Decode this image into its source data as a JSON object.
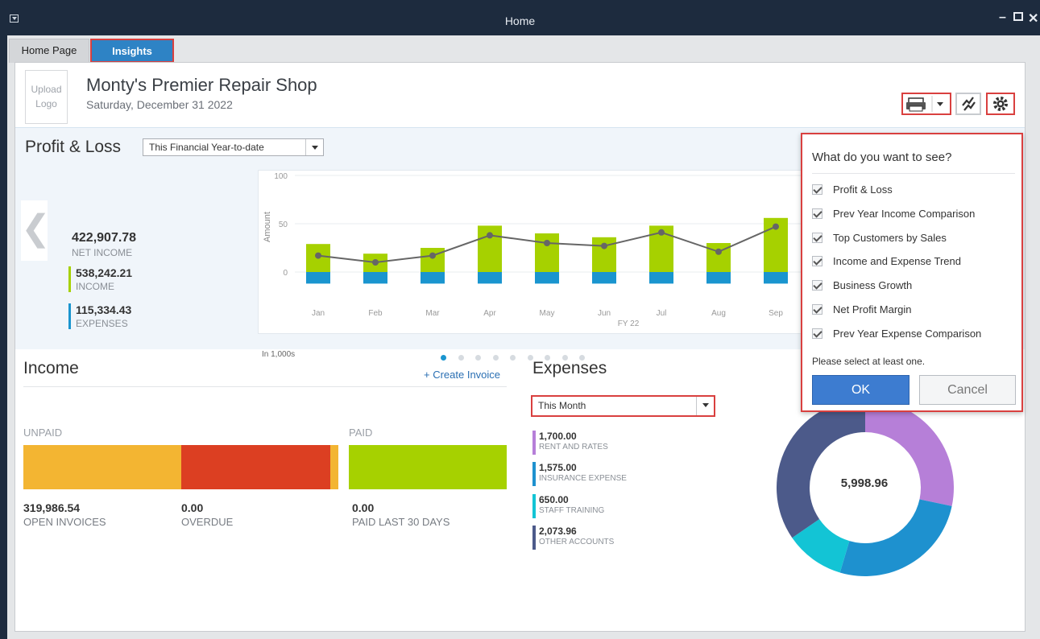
{
  "window": {
    "title": "Home"
  },
  "tabs": [
    {
      "label": "Home Page"
    },
    {
      "label": "Insights"
    }
  ],
  "header": {
    "logo_text": "Upload Logo",
    "company": "Monty's Premier Repair Shop",
    "date": "Saturday, December 31 2022"
  },
  "profit_loss": {
    "title": "Profit & Loss",
    "period": "This Financial Year-to-date",
    "net_income": "422,907.78",
    "net_income_label": "NET INCOME",
    "income": "538,242.21",
    "income_label": "INCOME",
    "expenses": "115,334.43",
    "expenses_label": "EXPENSES",
    "units_note": "In 1,000s"
  },
  "chart_data": {
    "type": "bar",
    "categories": [
      "Jan",
      "Feb",
      "Mar",
      "Apr",
      "May",
      "Jun",
      "Jul",
      "Aug",
      "Sep"
    ],
    "xlabel": "FY 22",
    "ylabel": "Amount",
    "yticks": [
      "100",
      "50",
      "0"
    ],
    "ylim": [
      -12,
      100
    ],
    "series": [
      {
        "values": [
          29,
          19,
          25,
          48,
          40,
          36,
          48,
          30,
          56
        ]
      },
      {
        "values": [
          -12,
          -12,
          -12,
          -12,
          -12,
          -12,
          -12,
          -12,
          -12
        ]
      },
      {
        "values": [
          17,
          10,
          17,
          38,
          30,
          27,
          41,
          21,
          47
        ]
      }
    ],
    "colors": {
      "income": "#a6d100",
      "expenses": "#1a95cf",
      "net": "#666666"
    },
    "grid": true
  },
  "income": {
    "title": "Income",
    "create_invoice": "+ Create Invoice",
    "unpaid_label": "UNPAID",
    "paid_label": "PAID",
    "open_invoices": "319,986.54",
    "open_invoices_label": "OPEN INVOICES",
    "overdue": "0.00",
    "overdue_label": "OVERDUE",
    "paid_last_30": "0.00",
    "paid_last_30_label": "PAID LAST 30 DAYS",
    "colors": {
      "open": "#f3b532",
      "overdue": "#dc3f22",
      "paid": "#a6d100"
    }
  },
  "expenses": {
    "title": "Expenses",
    "period": "This Month",
    "total": "5,998.96",
    "items": [
      {
        "value": "1,700.00",
        "label": "RENT AND RATES",
        "color": "#b67fd8"
      },
      {
        "value": "1,575.00",
        "label": "INSURANCE EXPENSE",
        "color": "#1e91cf"
      },
      {
        "value": "650.00",
        "label": "STAFF TRAINING",
        "color": "#13c4d5"
      },
      {
        "value": "2,073.96",
        "label": "OTHER ACCOUNTS",
        "color": "#4c5a8a"
      }
    ]
  },
  "popup": {
    "title": "What do you want to see?",
    "options": [
      {
        "label": "Profit & Loss",
        "checked": true
      },
      {
        "label": "Prev Year Income Comparison",
        "checked": true
      },
      {
        "label": "Top Customers by Sales",
        "checked": true
      },
      {
        "label": "Income and Expense Trend",
        "checked": true
      },
      {
        "label": "Business Growth",
        "checked": true
      },
      {
        "label": "Net Profit Margin",
        "checked": true
      },
      {
        "label": "Prev Year Expense Comparison",
        "checked": true
      }
    ],
    "note": "Please select at least one.",
    "ok": "OK",
    "cancel": "Cancel"
  }
}
